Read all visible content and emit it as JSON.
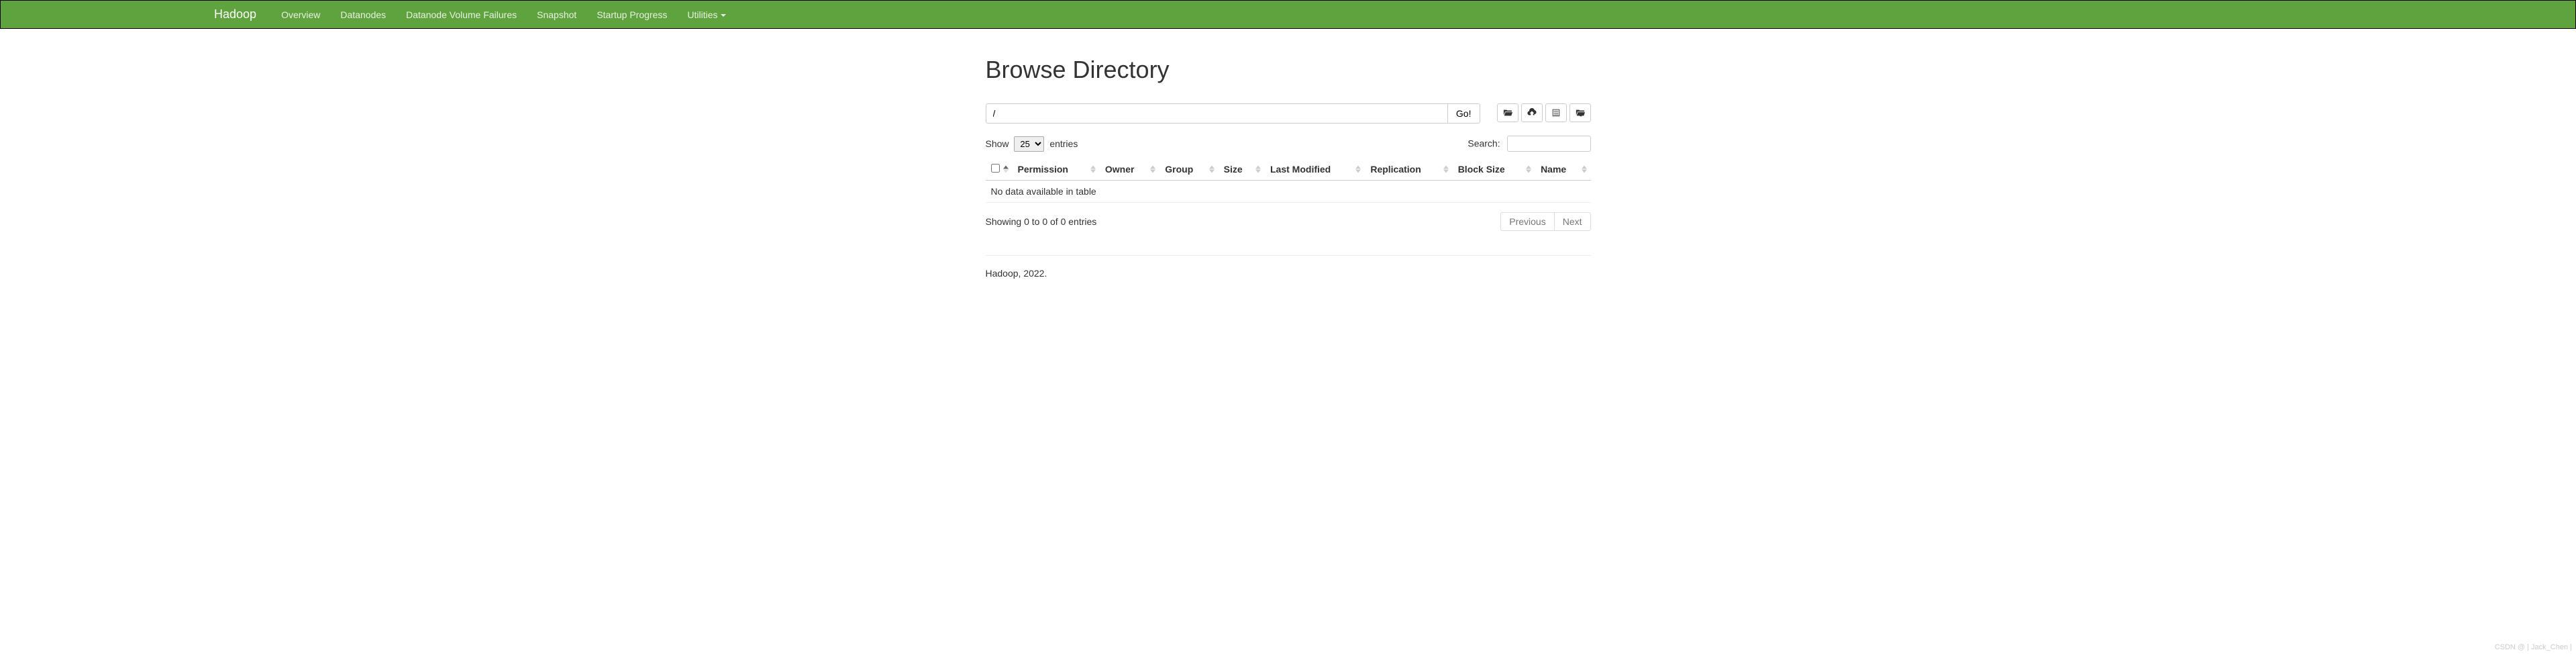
{
  "navbar": {
    "brand": "Hadoop",
    "items": [
      "Overview",
      "Datanodes",
      "Datanode Volume Failures",
      "Snapshot",
      "Startup Progress",
      "Utilities"
    ]
  },
  "page": {
    "title": "Browse Directory"
  },
  "path": {
    "value": "/",
    "go_label": "Go!"
  },
  "table_ctrl": {
    "show_label": "Show",
    "entries_label": "entries",
    "length_value": "25",
    "search_label": "Search:",
    "info_text": "Showing 0 to 0 of 0 entries",
    "prev_label": "Previous",
    "next_label": "Next"
  },
  "columns": {
    "permission": "Permission",
    "owner": "Owner",
    "group": "Group",
    "size": "Size",
    "last_modified": "Last Modified",
    "replication": "Replication",
    "block_size": "Block Size",
    "name": "Name"
  },
  "table": {
    "empty_text": "No data available in table"
  },
  "footer": {
    "text": "Hadoop, 2022."
  },
  "watermark": "CSDN @ | Jack_Chen |"
}
